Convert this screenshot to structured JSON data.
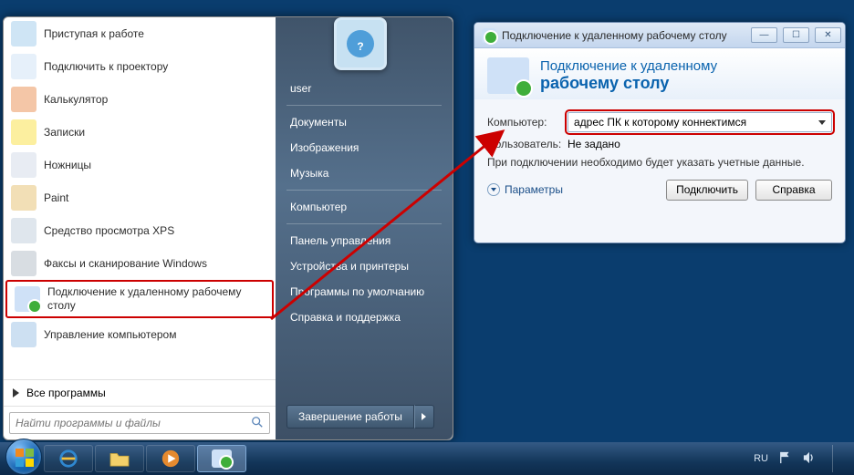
{
  "start_menu": {
    "programs": [
      {
        "label": "Приступая к работе",
        "icon": "i-start",
        "hasSub": true
      },
      {
        "label": "Подключить к проектору",
        "icon": "i-proj"
      },
      {
        "label": "Калькулятор",
        "icon": "i-calc"
      },
      {
        "label": "Записки",
        "icon": "i-note"
      },
      {
        "label": "Ножницы",
        "icon": "i-sniss"
      },
      {
        "label": "Paint",
        "icon": "i-paint"
      },
      {
        "label": "Средство просмотра XPS",
        "icon": "i-xps"
      },
      {
        "label": "Факсы и сканирование Windows",
        "icon": "i-fax"
      },
      {
        "label": "Подключение к удаленному рабочему столу",
        "icon": "i-rdp",
        "highlight": true
      },
      {
        "label": "Управление компьютером",
        "icon": "i-manage"
      }
    ],
    "all_programs": "Все программы",
    "search_placeholder": "Найти программы и файлы",
    "right_items_top": [
      "user"
    ],
    "right_items_mid1": [
      "Документы",
      "Изображения",
      "Музыка"
    ],
    "right_items_mid2": [
      "Компьютер"
    ],
    "right_items_mid3": [
      "Панель управления",
      "Устройства и принтеры",
      "Программы по умолчанию",
      "Справка и поддержка"
    ],
    "shutdown_label": "Завершение работы"
  },
  "rdp": {
    "title": "Подключение к удаленному рабочему столу",
    "head_line1": "Подключение к удаленному",
    "head_line2": "рабочему столу",
    "computer_label": "Компьютер:",
    "computer_value": "адрес ПК к которому коннектимся",
    "user_label": "Пользователь:",
    "user_value": "Не задано",
    "hint": "При подключении необходимо будет указать учетные данные.",
    "options_label": "Параметры",
    "connect_label": "Подключить",
    "help_label": "Справка"
  },
  "taskbar": {
    "lang": "RU"
  }
}
